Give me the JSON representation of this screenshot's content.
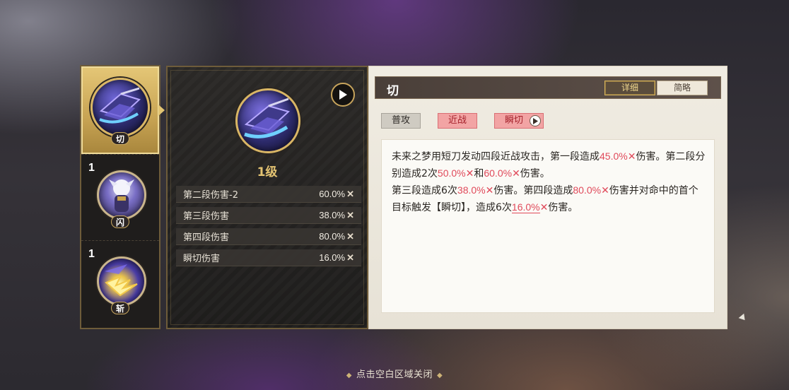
{
  "skill_slots": [
    {
      "tag": "切",
      "level": "",
      "active": true
    },
    {
      "tag": "闪",
      "level": "1",
      "active": false
    },
    {
      "tag": "斩",
      "level": "1",
      "active": false
    }
  ],
  "stat_panel": {
    "level": "1级",
    "rows": [
      {
        "label": "第二段伤害-2",
        "value": "60.0%"
      },
      {
        "label": "第三段伤害",
        "value": "38.0%"
      },
      {
        "label": "第四段伤害",
        "value": "80.0%"
      },
      {
        "label": "瞬切伤害",
        "value": "16.0%"
      }
    ],
    "multiplier_symbol": "✕"
  },
  "detail": {
    "skill_name": "切",
    "tabs": [
      {
        "label": "详细",
        "active": true
      },
      {
        "label": "简略",
        "active": false
      }
    ],
    "tags": [
      "普攻",
      "近战",
      "瞬切"
    ],
    "desc": {
      "p1": "未来之梦用短刀发动四段近战攻击，第一段造成",
      "v1": "45.0%",
      "p2": "伤害。第二段分别造成2次",
      "v2": "50.0%",
      "p3": "和",
      "v3": "60.0%",
      "p4": "伤害。",
      "p5": "第三段造成6次",
      "v4": "38.0%",
      "p6": "伤害。第四段造成",
      "v5": "80.0%",
      "p7": "伤害并对命中的首个目标触发【瞬切】，造成6次",
      "v6": "16.0%",
      "p8": "伤害。",
      "x": "✕"
    }
  },
  "footer": {
    "hint": "点击空白区域关闭",
    "decor": "◆"
  },
  "colors": {
    "accent_gold": "#e3c372",
    "highlight_red": "#e0495a",
    "tag_red_bg": "#f2a4a4"
  }
}
